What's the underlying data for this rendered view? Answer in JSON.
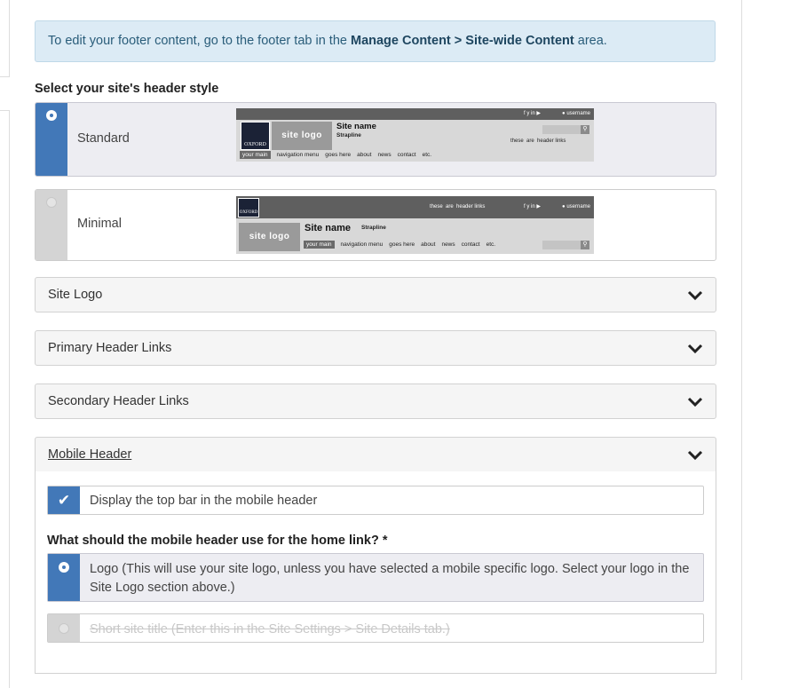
{
  "info": {
    "prefix": "To edit your footer content, go to the footer tab in the ",
    "bold": "Manage Content > Site-wide Content",
    "suffix": " area."
  },
  "header_style": {
    "label": "Select your site's header style",
    "options": [
      {
        "label": "Standard",
        "selected": true
      },
      {
        "label": "Minimal",
        "selected": false
      }
    ]
  },
  "preview": {
    "oxford_label": "OXFORD",
    "site_logo": "site logo",
    "site_name": "Site name",
    "strapline": "Strapline",
    "username": "username",
    "header_links": [
      "these",
      "are",
      "header links"
    ],
    "social": "f  y  in  ▶",
    "nav": [
      "your main",
      "navigation menu",
      "goes here",
      "about",
      "news",
      "contact",
      "etc."
    ]
  },
  "accordions": [
    {
      "title": "Site Logo",
      "expanded": false
    },
    {
      "title": "Primary Header Links",
      "expanded": false
    },
    {
      "title": "Secondary Header Links",
      "expanded": false
    },
    {
      "title": "Mobile Header",
      "expanded": true
    }
  ],
  "mobile": {
    "top_bar_label": "Display the top bar in the mobile header",
    "top_bar_checked": true,
    "home_link_label": "What should the mobile header use for the home link? *",
    "home_options": [
      {
        "label": "Logo (This will use your site logo, unless you have selected a mobile specific logo. Select your logo in the Site Logo section above.)",
        "selected": true,
        "disabled": false
      },
      {
        "label": "Short site title (Enter this in the Site Settings > Site Details tab.)",
        "selected": false,
        "disabled": true
      }
    ]
  },
  "colors": {
    "accent": "#4278b8",
    "info_bg": "#dcebf5"
  }
}
